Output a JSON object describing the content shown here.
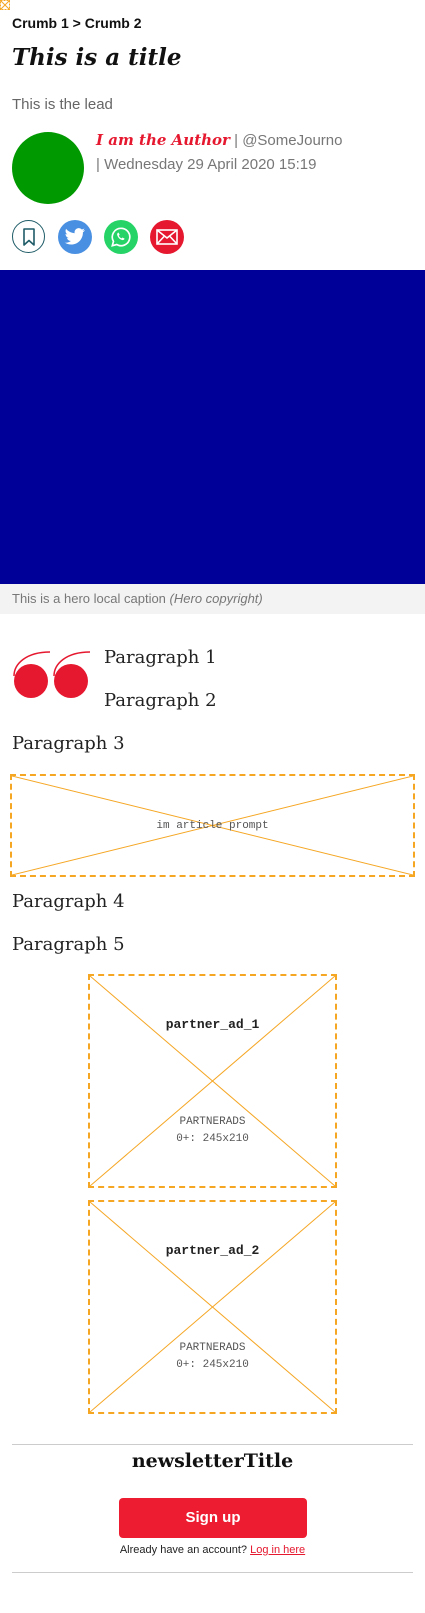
{
  "breadcrumb": {
    "text": "Crumb 1 > Crumb 2"
  },
  "article": {
    "title": "This is a title",
    "lead": "This is the lead",
    "author": "I am the Author",
    "author_separator": "|",
    "twitter_handle": "@SomeJourno",
    "date_separator": "|",
    "date": "Wednesday 29 April 2020 15:19"
  },
  "share": {
    "icons": [
      "bookmark-icon",
      "twitter-icon",
      "whatsapp-icon",
      "email-icon"
    ],
    "colors": {
      "bookmark": "#1f5c68",
      "twitter": "#4a90e2",
      "whatsapp": "#25d366",
      "email": "#e5182f"
    }
  },
  "hero": {
    "color": "#000099",
    "caption": "This is a hero local caption",
    "copyright": "(Hero copyright)"
  },
  "body": {
    "paragraphs": [
      "Paragraph 1",
      "Paragraph 2",
      "Paragraph 3",
      "Paragraph 4",
      "Paragraph 5"
    ]
  },
  "ads": {
    "prompt": {
      "label": "im article prompt"
    },
    "partner_1": {
      "title": "partner_ad_1",
      "line1": "PARTNERADS",
      "line2": "0+: 245x210"
    },
    "partner_2": {
      "title": "partner_ad_2",
      "line1": "PARTNERADS",
      "line2": "0+: 245x210"
    }
  },
  "newsletter": {
    "title": "newsletterTitle",
    "signup_label": "Sign up",
    "login_prompt": "Already have an account?",
    "login_link": "Log in here"
  },
  "colors": {
    "brand_red": "#ed1c31",
    "avatar": "#009900",
    "ad_border": "#f5a623"
  }
}
